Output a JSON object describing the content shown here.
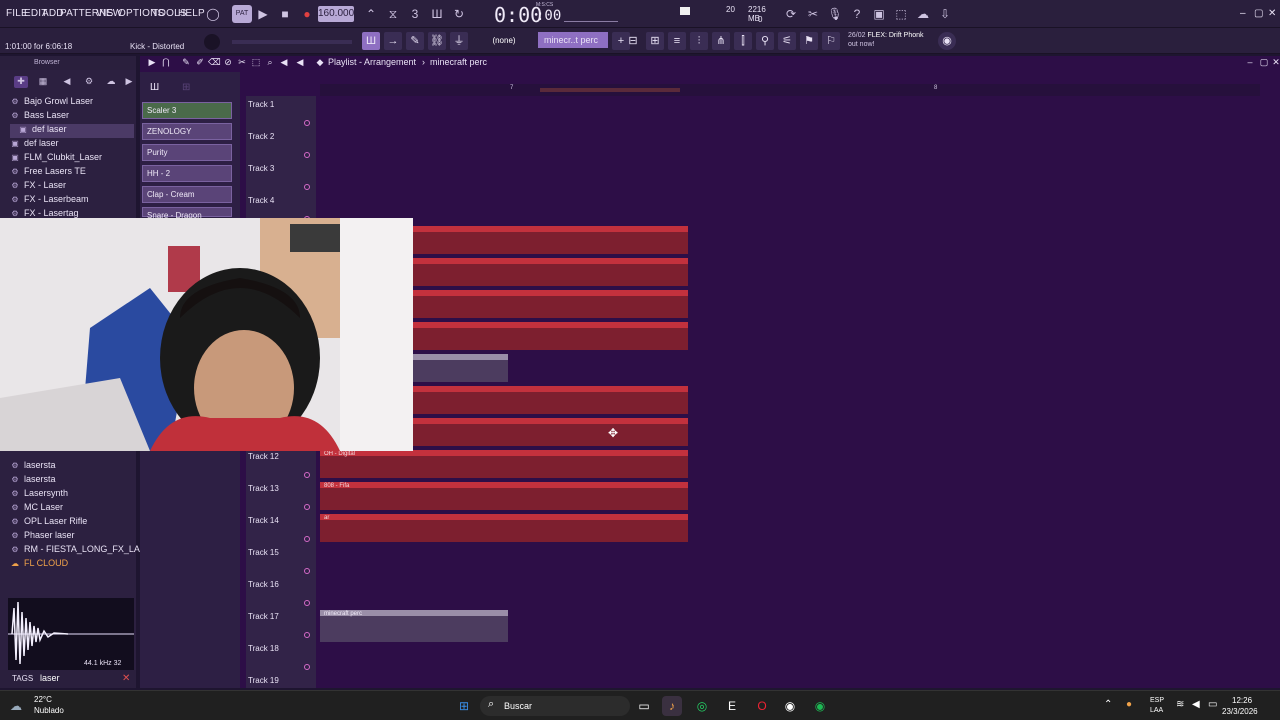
{
  "menu": [
    "FILE",
    "EDIT",
    "ADD",
    "PATTERNS",
    "VIEW",
    "OPTIONS",
    "TOOLS",
    "HELP"
  ],
  "transport": {
    "tempo": "160.000",
    "time": "0:00",
    "time_frac": ":00",
    "time_unit": "M:S:CS"
  },
  "perf": {
    "cpu": "20",
    "ram": "2216 MB",
    "voices": "0"
  },
  "hint": {
    "position": "1:01:00 for 6:06:18",
    "channel": "Kick - Distorted"
  },
  "toolbar": {
    "pattern_none": "(none)",
    "pattern_selected": "minecr..t perc"
  },
  "news": {
    "date": "26/02",
    "headline": "FLEX: Drift Phonk",
    "tail": "out now!"
  },
  "browser": {
    "header": "Browser",
    "items": [
      {
        "label": "Bajo Growl Laser",
        "icon": "gear-icon"
      },
      {
        "label": "Bass Laser",
        "icon": "gear-icon"
      },
      {
        "label": "def laser",
        "icon": "folder-icon"
      },
      {
        "label": "def laser",
        "icon": "folder-icon"
      },
      {
        "label": "FLM_Clubkit_Laser",
        "icon": "folder-icon"
      },
      {
        "label": "Free Lasers TE",
        "icon": "gear-icon"
      },
      {
        "label": "FX - Laser",
        "icon": "gear-icon"
      },
      {
        "label": "FX - Laserbeam",
        "icon": "gear-icon"
      },
      {
        "label": "FX - Lasertag",
        "icon": "gear-icon"
      }
    ],
    "items_lower": [
      {
        "label": "lasersta",
        "icon": "gear-icon"
      },
      {
        "label": "lasersta",
        "icon": "gear-icon"
      },
      {
        "label": "lasersta",
        "icon": "gear-icon"
      },
      {
        "label": "Lasersynth",
        "icon": "gear-icon"
      },
      {
        "label": "MC Laser",
        "icon": "gear-icon"
      },
      {
        "label": "OPL Laser Rifle",
        "icon": "gear-icon"
      },
      {
        "label": "Phaser laser",
        "icon": "gear-icon"
      },
      {
        "label": "RM - FIESTA_LONG_FX_LASER",
        "icon": "gear-icon"
      },
      {
        "label": "FL CLOUD",
        "icon": "cloud-icon"
      }
    ],
    "sample_rate": "44.1 kHz 32",
    "tags_label": "TAGS",
    "tags_value": "laser"
  },
  "playlist": {
    "title": "Playlist - Arrangement",
    "pattern": "minecraft perc",
    "patterns": [
      "Scaler 3",
      "ZENOLOGY",
      "Purity",
      "HH - 2",
      "Clap - Cream",
      "Snare - Dragon"
    ],
    "ruler": [
      "7",
      "8"
    ],
    "tracks": [
      "Track 1",
      "Track 2",
      "Track 3",
      "Track 4",
      "Track 12",
      "Track 13",
      "Track 14",
      "Track 15",
      "Track 16",
      "Track 17",
      "Track 18",
      "Track 19"
    ],
    "clips": {
      "track12": "OH - Digital",
      "track13": "808 - Fifa",
      "track14": "ar",
      "track17": "minecraft perc"
    }
  },
  "taskbar": {
    "weather_temp": "22°C",
    "weather_desc": "Nublado",
    "search": "Buscar",
    "lang1": "ESP",
    "lang2": "LAA",
    "clock": "12:26",
    "date": "23/3/2026"
  }
}
